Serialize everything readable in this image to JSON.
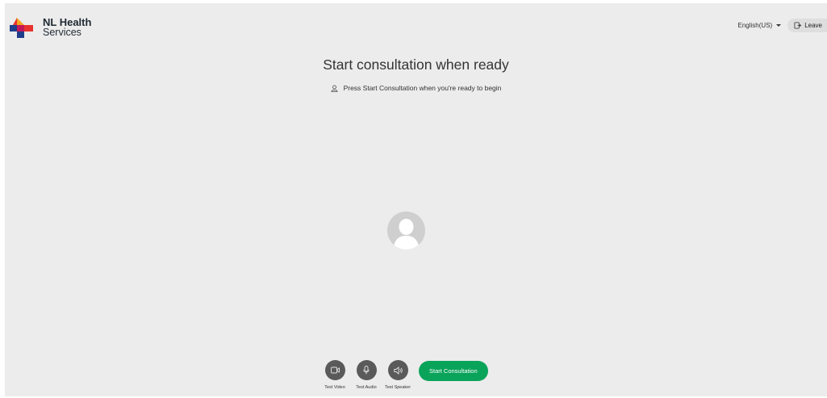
{
  "brand": {
    "line1": "NL Health",
    "line2": "Services"
  },
  "header": {
    "language": "English(US)",
    "leave_label": "Leave"
  },
  "main": {
    "title": "Start consultation when ready",
    "subtitle": "Press Start Consultation when you're ready to begin"
  },
  "controls": {
    "test_video": "Test Video",
    "test_audio": "Test Audio",
    "test_speaker": "Test Speaker",
    "start_label": "Start Consultation"
  },
  "colors": {
    "background": "#ececec",
    "start_button": "#0aa35a",
    "control_button": "#5a5a5a",
    "logo_red": "#e8322e",
    "logo_orange": "#f5a623",
    "logo_blue": "#1f3d8b"
  },
  "icons": [
    "nl-health-logo",
    "caret-down-icon",
    "leave-icon",
    "user-icon",
    "avatar-placeholder",
    "video-icon",
    "microphone-icon",
    "speaker-icon"
  ]
}
